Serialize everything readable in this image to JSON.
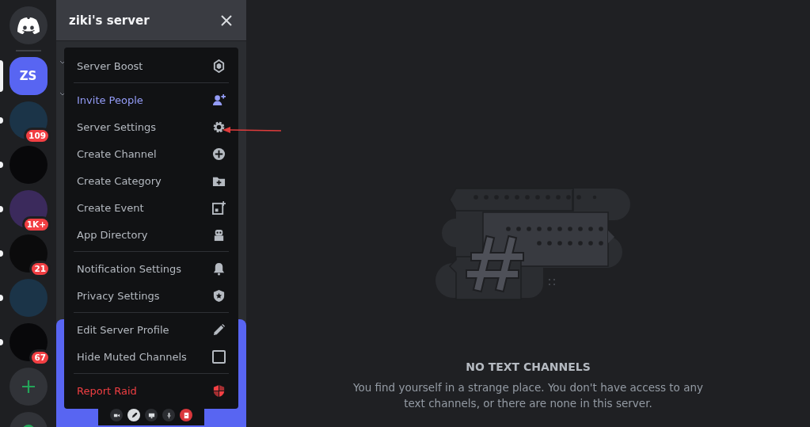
{
  "servers": [
    {
      "kind": "home",
      "selected": false,
      "unread": false
    },
    {
      "kind": "initials",
      "label": "ZS",
      "selected": true
    },
    {
      "kind": "image",
      "badge": "109",
      "selected": false,
      "unread": true
    },
    {
      "kind": "image",
      "selected": false,
      "unread": true
    },
    {
      "kind": "image",
      "badge": "1K+",
      "selected": false,
      "unread": true
    },
    {
      "kind": "image",
      "badge": "21",
      "selected": false,
      "unread": true
    },
    {
      "kind": "image",
      "selected": false,
      "unread": true
    },
    {
      "kind": "image",
      "badge": "67",
      "selected": false,
      "unread": true
    },
    {
      "kind": "add",
      "selected": false,
      "unread": false
    },
    {
      "kind": "explore",
      "selected": false
    }
  ],
  "server_header": {
    "title": "ziki's server"
  },
  "menu": {
    "groups": [
      [
        {
          "label": "Server Boost",
          "kind": "normal"
        }
      ],
      [
        {
          "label": "Invite People",
          "kind": "accent"
        },
        {
          "label": "Server Settings",
          "kind": "normal"
        },
        {
          "label": "Create Channel",
          "kind": "normal"
        },
        {
          "label": "Create Category",
          "kind": "normal"
        },
        {
          "label": "Create Event",
          "kind": "normal"
        },
        {
          "label": "App Directory",
          "kind": "normal"
        }
      ],
      [
        {
          "label": "Notification Settings",
          "kind": "normal"
        },
        {
          "label": "Privacy Settings",
          "kind": "normal"
        }
      ],
      [
        {
          "label": "Edit Server Profile",
          "kind": "normal"
        },
        {
          "label": "Hide Muted Channels",
          "kind": "checkbox",
          "checked": false
        }
      ],
      [
        {
          "label": "Report Raid",
          "kind": "danger"
        }
      ]
    ]
  },
  "empty_state": {
    "title": "NO TEXT CHANNELS",
    "message": "You find yourself in a strange place. You don't have access to any text channels, or there are none in this server."
  }
}
